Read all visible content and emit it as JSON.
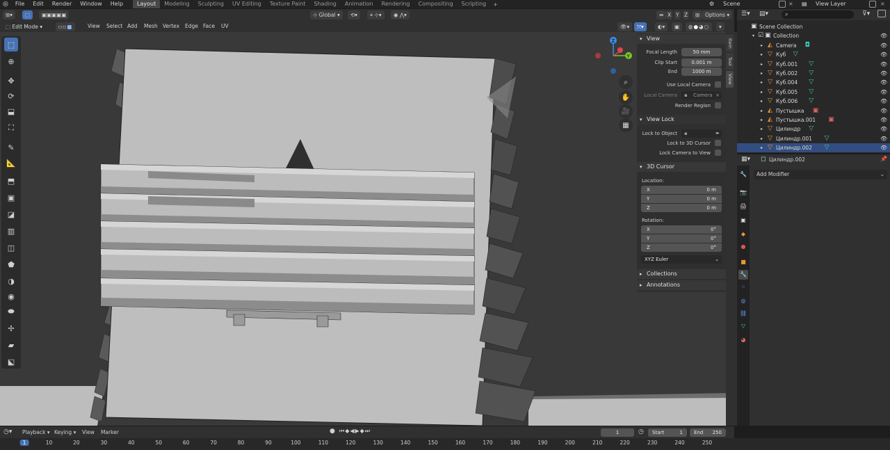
{
  "topbar": {
    "menus": [
      "File",
      "Edit",
      "Render",
      "Window",
      "Help"
    ],
    "workspaces": [
      "Layout",
      "Modeling",
      "Sculpting",
      "UV Editing",
      "Texture Paint",
      "Shading",
      "Animation",
      "Rendering",
      "Compositing",
      "Scripting"
    ],
    "active_workspace": "Layout",
    "scene": "Scene",
    "view_layer": "View Layer"
  },
  "viewport_header": {
    "mode": "Edit Mode",
    "menus": [
      "View",
      "Select",
      "Add",
      "Mesh",
      "Vertex",
      "Edge",
      "Face",
      "UV"
    ],
    "transform_orientation": "Global",
    "options": "Options",
    "axes": [
      "X",
      "Y",
      "Z"
    ]
  },
  "npanel": {
    "tabs": [
      "Item",
      "Tool",
      "View"
    ],
    "active_tab": "View",
    "view": {
      "title": "View",
      "focal_length_label": "Focal Length",
      "focal_length": "50 mm",
      "clip_start_label": "Clip Start",
      "clip_start": "0.001 m",
      "end_label": "End",
      "clip_end": "1000 m",
      "use_local_camera": "Use Local Camera",
      "local_camera_label": "Local Camera",
      "local_camera_value": "Camera",
      "render_region": "Render Region"
    },
    "view_lock": {
      "title": "View Lock",
      "lock_to_object": "Lock to Object",
      "lock_to_3d_cursor": "Lock to 3D Cursor",
      "lock_camera_to_view": "Lock Camera to View"
    },
    "cursor": {
      "title": "3D Cursor",
      "location_label": "Location:",
      "location": [
        {
          "k": "X",
          "v": "0 m"
        },
        {
          "k": "Y",
          "v": "0 m"
        },
        {
          "k": "Z",
          "v": "0 m"
        }
      ],
      "rotation_label": "Rotation:",
      "rotation": [
        {
          "k": "X",
          "v": "0°"
        },
        {
          "k": "Y",
          "v": "0°"
        },
        {
          "k": "Z",
          "v": "0°"
        }
      ],
      "rotation_mode": "XYZ Euler"
    },
    "collections": "Collections",
    "annotations": "Annotations"
  },
  "outliner": {
    "search_placeholder": "",
    "items": [
      {
        "name": "Scene Collection",
        "kind": "scene",
        "selected": false
      },
      {
        "name": "Collection",
        "kind": "collection",
        "selected": false
      },
      {
        "name": "Camera",
        "kind": "camera",
        "selected": false
      },
      {
        "name": "Куб",
        "kind": "mesh",
        "selected": false
      },
      {
        "name": "Куб.001",
        "kind": "mesh",
        "selected": false
      },
      {
        "name": "Куб.002",
        "kind": "mesh",
        "selected": false
      },
      {
        "name": "Куб.004",
        "kind": "mesh",
        "selected": false
      },
      {
        "name": "Куб.005",
        "kind": "mesh",
        "selected": false
      },
      {
        "name": "Куб.006",
        "kind": "mesh",
        "selected": false
      },
      {
        "name": "Пустышка",
        "kind": "empty",
        "selected": false
      },
      {
        "name": "Пустышка.001",
        "kind": "empty",
        "selected": false
      },
      {
        "name": "Цилиндр",
        "kind": "mesh",
        "selected": false
      },
      {
        "name": "Цилиндр.001",
        "kind": "mesh",
        "selected": false
      },
      {
        "name": "Цилиндр.002",
        "kind": "mesh",
        "selected": true
      }
    ]
  },
  "properties": {
    "object_name": "Цилиндр.002",
    "add_modifier": "Add Modifier"
  },
  "timeline": {
    "menus": [
      "Playback",
      "Keying",
      "View",
      "Marker"
    ],
    "current_frame": "1",
    "start_label": "Start",
    "start": "1",
    "end_label": "End",
    "end": "250",
    "ticks": [
      "1",
      "10",
      "20",
      "30",
      "40",
      "50",
      "60",
      "70",
      "80",
      "90",
      "100",
      "110",
      "120",
      "130",
      "140",
      "150",
      "160",
      "170",
      "180",
      "190",
      "200",
      "210",
      "220",
      "230",
      "240",
      "250"
    ]
  },
  "colors": {
    "accent": "#4772b3",
    "selected_row": "#334d80",
    "mesh_icon": "#3ec7b0",
    "object_icon": "#e8963a",
    "gizmo_x": "#e0434f",
    "gizmo_y": "#7cc524",
    "gizmo_z": "#3f8ce8"
  }
}
